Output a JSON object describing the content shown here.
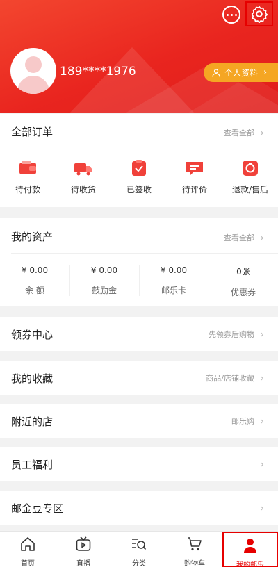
{
  "header": {
    "username": "189****1976",
    "profile_button": "个人资料",
    "colors": {
      "primary": "#e9251f",
      "profile_button": "#f5a623"
    }
  },
  "orders": {
    "title": "全部订单",
    "view_all": "查看全部",
    "items": [
      {
        "label": "待付款",
        "icon": "wallet-icon"
      },
      {
        "label": "待收货",
        "icon": "truck-icon"
      },
      {
        "label": "已签收",
        "icon": "signed-icon"
      },
      {
        "label": "待评价",
        "icon": "comment-icon"
      },
      {
        "label": "退款/售后",
        "icon": "refund-icon"
      }
    ]
  },
  "assets": {
    "title": "我的资产",
    "view_all": "查看全部",
    "items": [
      {
        "value": "¥ 0.00",
        "label": "余 额"
      },
      {
        "value": "¥ 0.00",
        "label": "鼓励金"
      },
      {
        "value": "¥ 0.00",
        "label": "邮乐卡"
      },
      {
        "value": "0张",
        "label": "优惠券"
      }
    ]
  },
  "rows": [
    {
      "title": "领券中心",
      "hint": "先领券后购物"
    },
    {
      "title": "我的收藏",
      "hint": "商品/店铺收藏"
    },
    {
      "title": "附近的店",
      "hint": "邮乐购"
    },
    {
      "title": "员工福利",
      "hint": ""
    },
    {
      "title": "邮金豆专区",
      "hint": ""
    }
  ],
  "tabbar": {
    "items": [
      {
        "label": "首页",
        "icon": "home-icon"
      },
      {
        "label": "直播",
        "icon": "tv-icon"
      },
      {
        "label": "分类",
        "icon": "category-search-icon"
      },
      {
        "label": "购物车",
        "icon": "cart-icon"
      },
      {
        "label": "我的邮乐",
        "icon": "person-icon",
        "active": true
      }
    ]
  }
}
